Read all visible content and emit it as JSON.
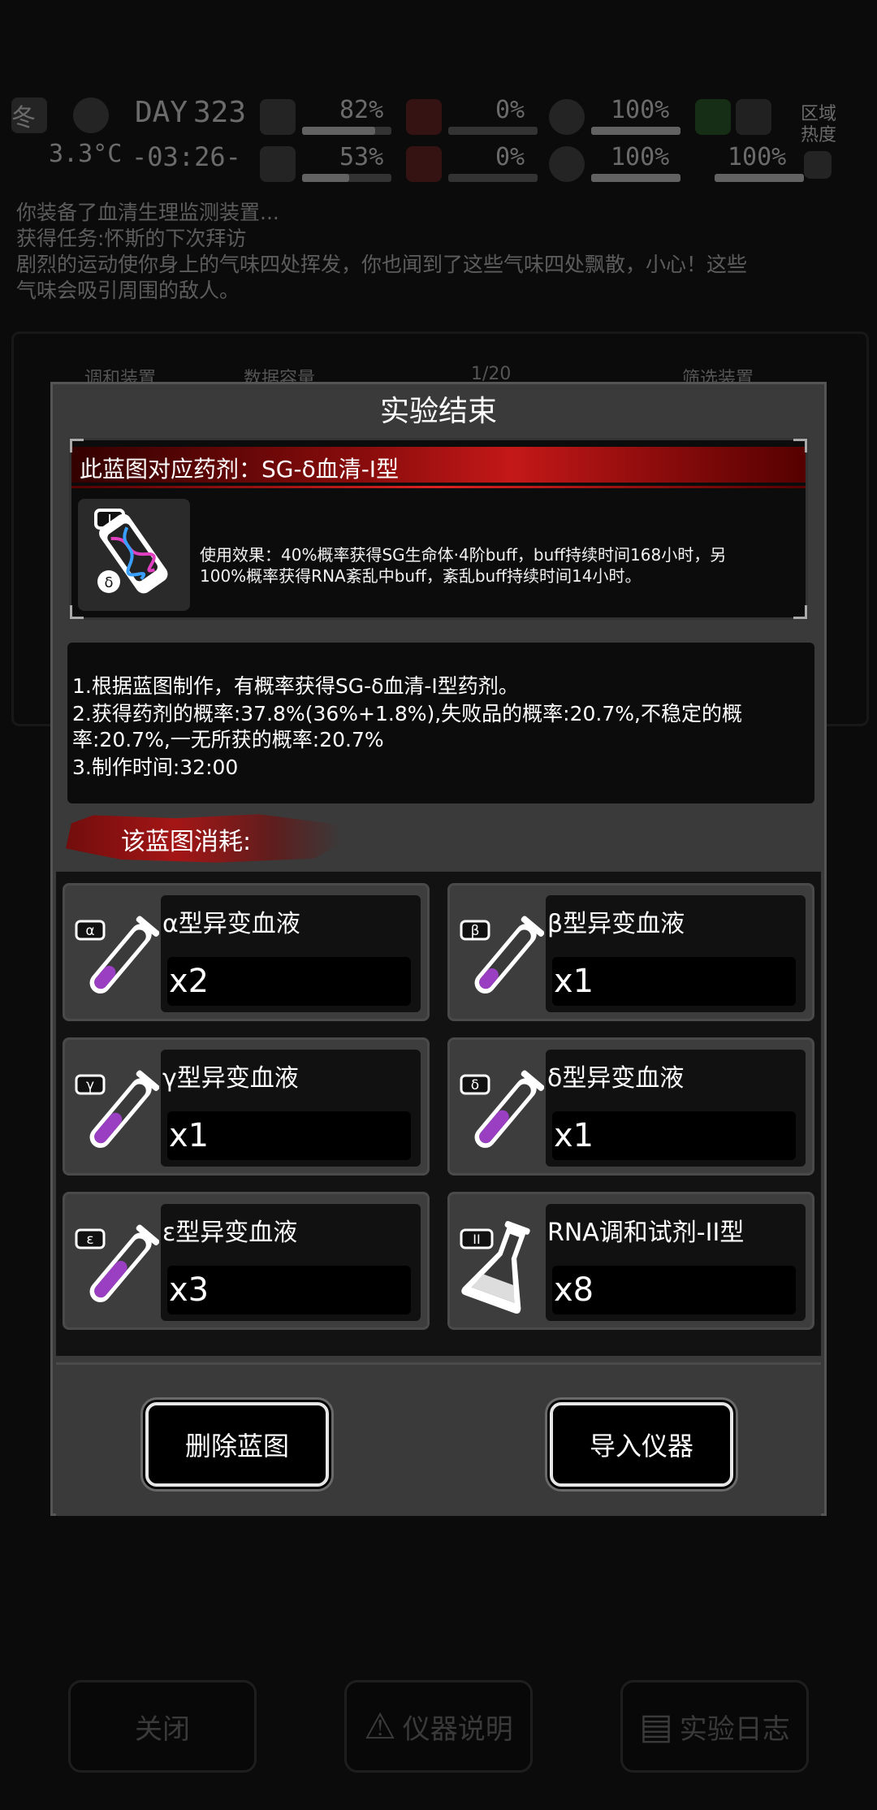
{
  "hud": {
    "season": "冬",
    "temperature": "3.3°C",
    "day_label": "DAY",
    "day_number": "323",
    "clock": "-03:26-",
    "stat_top": [
      "82%",
      "0%",
      "100%"
    ],
    "stat_bottom": [
      "53%",
      "0%",
      "100%",
      "100%"
    ],
    "region_label": "区域热度",
    "stat_top_levels": [
      82,
      0,
      100
    ],
    "stat_bottom_levels": [
      53,
      0,
      100,
      100
    ]
  },
  "log": [
    "你装备了血清生理监测装置...",
    "获得任务:怀斯的下次拜访",
    "剧烈的运动使你身上的气味四处挥发，你也闻到了这些气味四处飘散，小心！这些",
    "气味会吸引周围的敌人。"
  ],
  "bg_panel": {
    "left_label": "调和装置",
    "capacity_label": "数据容量",
    "capacity": "1/20",
    "filter_label": "筛选装置"
  },
  "modal": {
    "title": "实验结束",
    "blueprint_name": "此蓝图对应药剂：SG-δ血清-I型",
    "blueprint_icon": "serum-vial-icon",
    "effect_lines": [
      "使用效果：40%概率获得SG生命体·4阶buff，buff持续时间168小时，另",
      "100%概率获得RNA紊乱中buff，紊乱buff持续时间14小时。"
    ],
    "description_lines": [
      "1.根据蓝图制作，有概率获得SG-δ血清-I型药剂。",
      "2.获得药剂的概率:37.8%(36%+1.8%),失败品的概率:20.7%,不稳定的概",
      "率:20.7%,一无所获的概率:20.7%",
      "3.制作时间:32:00"
    ],
    "cost_title": "该蓝图消耗:",
    "materials": [
      {
        "name": "α型异变血液",
        "qty": "x2",
        "badge": "α",
        "icon": "test-tube-icon"
      },
      {
        "name": "β型异变血液",
        "qty": "x1",
        "badge": "β",
        "icon": "test-tube-icon"
      },
      {
        "name": "γ型异变血液",
        "qty": "x1",
        "badge": "γ",
        "icon": "test-tube-icon"
      },
      {
        "name": "δ型异变血液",
        "qty": "x1",
        "badge": "δ",
        "icon": "test-tube-icon"
      },
      {
        "name": "ε型异变血液",
        "qty": "x3",
        "badge": "ε",
        "icon": "test-tube-icon"
      },
      {
        "name": "RNA调和试剂-II型",
        "qty": "x8",
        "badge": "II",
        "icon": "flask-icon"
      }
    ],
    "delete_button": "删除蓝图",
    "import_button": "导入仪器"
  },
  "bottom_bar": {
    "close": "关闭",
    "instrument_help": "仪器说明",
    "experiment_log": "实验日志"
  },
  "colors": {
    "accent_red": "#c41818",
    "liquid_purple": "#9a3fc2",
    "panel": "#3a3a3a"
  }
}
